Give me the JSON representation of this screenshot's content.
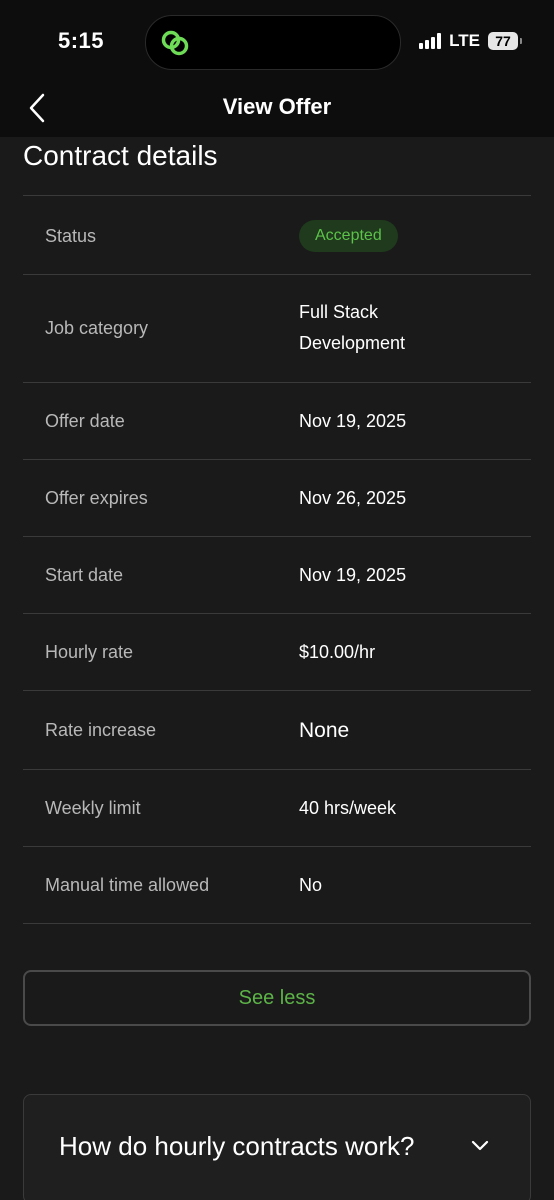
{
  "status_bar": {
    "time": "5:15",
    "network": "LTE",
    "battery": "77"
  },
  "header": {
    "title": "View Offer"
  },
  "contract": {
    "section_title": "Contract details",
    "rows": [
      {
        "label": "Status",
        "value": "Accepted"
      },
      {
        "label": "Job category",
        "value": "Full Stack Development"
      },
      {
        "label": "Offer date",
        "value": "Nov 19, 2025"
      },
      {
        "label": "Offer expires",
        "value": "Nov 26, 2025"
      },
      {
        "label": "Start date",
        "value": "Nov 19, 2025"
      },
      {
        "label": "Hourly rate",
        "value": "$10.00/hr"
      },
      {
        "label": "Rate increase",
        "value": "None"
      },
      {
        "label": "Weekly limit",
        "value": "40 hrs/week"
      },
      {
        "label": "Manual time allowed",
        "value": "No"
      }
    ]
  },
  "actions": {
    "see_less_label": "See less"
  },
  "faq": {
    "title": "How do hourly contracts work?"
  },
  "colors": {
    "background": "#1a1a1a",
    "accent_green": "#5cb347",
    "badge_bg": "#1f3a1c"
  },
  "icons": {
    "back": "chevron-left-icon",
    "faq_toggle": "chevron-down-icon",
    "app": "upwork-logo-icon"
  }
}
